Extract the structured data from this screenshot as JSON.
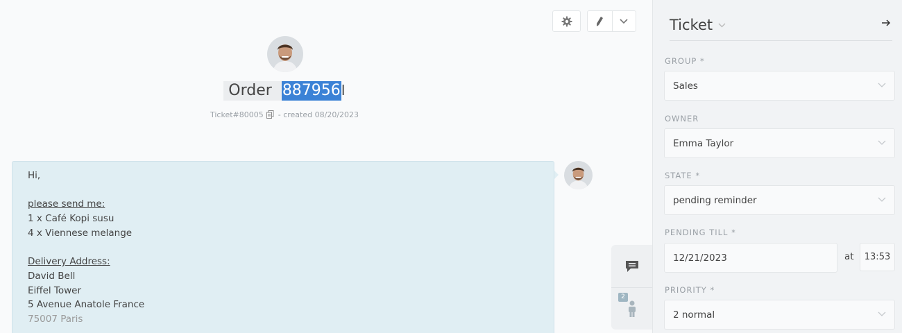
{
  "ticket": {
    "title_prefix": "Order",
    "title_number": "887956",
    "number_label": "Ticket#80005",
    "created_label": "- created 08/20/2023"
  },
  "article": {
    "lines": [
      {
        "text": "Hi,",
        "style": "normal"
      },
      {
        "text": "",
        "style": "blank"
      },
      {
        "text": "please send me:",
        "style": "underline"
      },
      {
        "text": "1 x Café Kopi susu",
        "style": "normal"
      },
      {
        "text": "4 x Viennese melange",
        "style": "normal"
      },
      {
        "text": "",
        "style": "blank"
      },
      {
        "text": "Delivery Address:",
        "style": "underline"
      },
      {
        "text": "David Bell",
        "style": "normal"
      },
      {
        "text": "Eiffel Tower",
        "style": "normal"
      },
      {
        "text": "5 Avenue Anatole France",
        "style": "normal"
      },
      {
        "text": "75007 Paris",
        "style": "fade"
      }
    ]
  },
  "side_tabs": {
    "customer_badge": "2"
  },
  "sidebar": {
    "title": "Ticket",
    "fields": {
      "group": {
        "label": "GROUP *",
        "value": "Sales"
      },
      "owner": {
        "label": "OWNER",
        "value": "Emma Taylor"
      },
      "state": {
        "label": "STATE *",
        "value": "pending reminder"
      },
      "pending_till": {
        "label": "PENDING TILL *",
        "date": "12/21/2023",
        "at": "at",
        "time": "13:53"
      },
      "priority": {
        "label": "PRIORITY *",
        "value": "2 normal"
      }
    }
  },
  "colors": {
    "selection": "#3b82d6",
    "bubble": "#e0eef3",
    "sidebar_bg": "#f1f3f5"
  },
  "icons": [
    "gear-icon",
    "pencil-icon",
    "chevron-down-icon",
    "copy-icon",
    "chat-icon",
    "customer-icon",
    "arrow-right-icon"
  ]
}
